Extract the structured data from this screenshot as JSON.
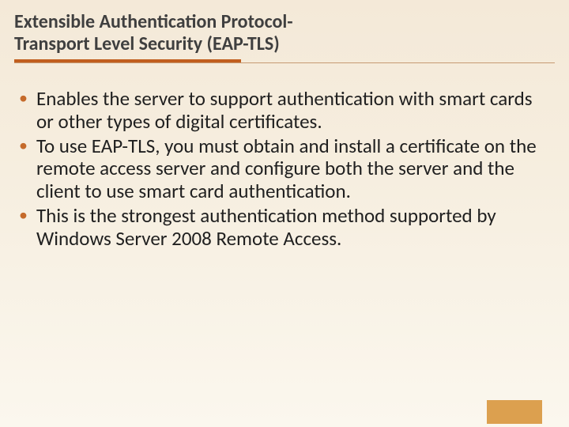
{
  "title_line1": "Extensible Authentication Protocol-",
  "title_line2": "Transport Level Security (EAP-TLS)",
  "bullets": [
    "Enables the server to support authentication with smart cards or other types of digital certificates.",
    "To use EAP-TLS, you must obtain and install a certificate on the remote access server and configure both the server and the client to use smart card authentication.",
    "This is the strongest authentication method supported by Windows Server 2008 Remote Access."
  ]
}
